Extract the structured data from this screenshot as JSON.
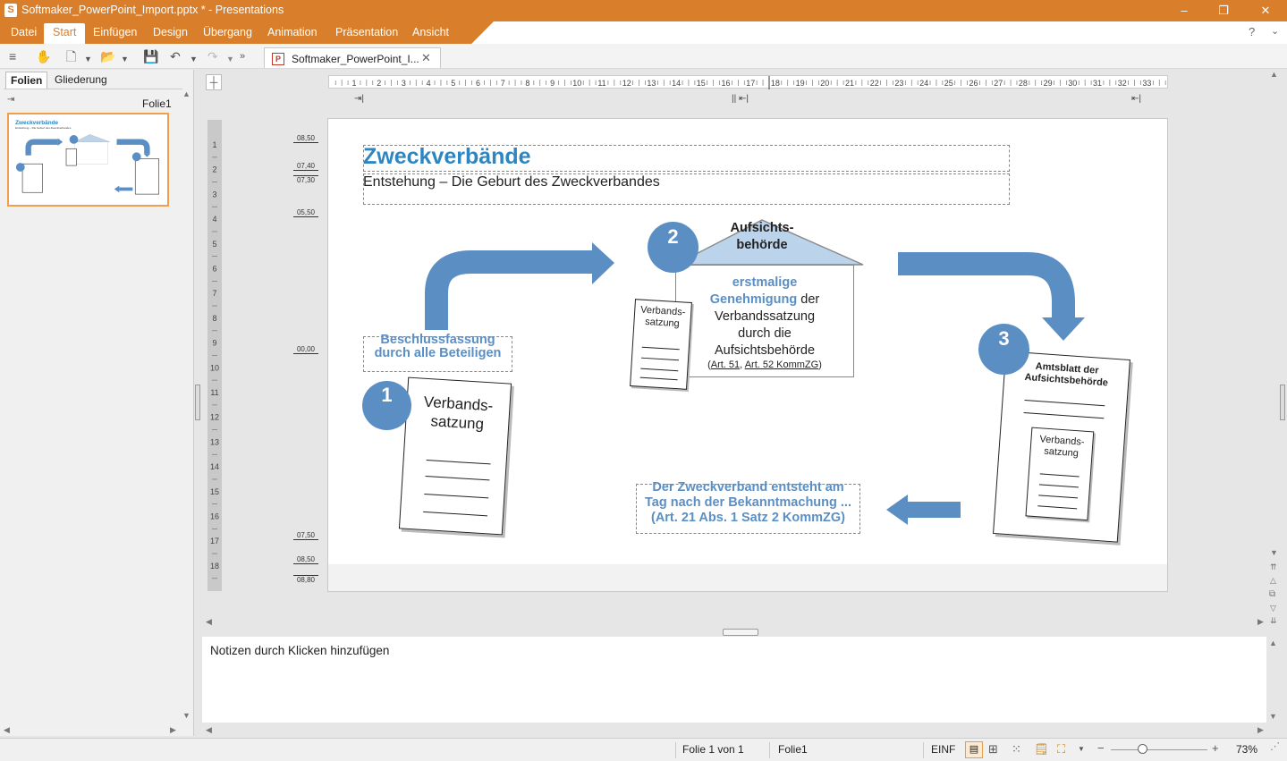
{
  "window": {
    "title": "Softmaker_PowerPoint_Import.pptx * - Presentations",
    "app_icon": "S"
  },
  "menu": [
    "Datei",
    "Start",
    "Einfügen",
    "Design",
    "Übergang",
    "Animation",
    "Präsentation",
    "Ansicht"
  ],
  "document_tab": "Softmaker_PowerPoint_I...",
  "left_panel": {
    "tabs": [
      "Folien",
      "Gliederung"
    ],
    "slide_label": "Folie1"
  },
  "horizontal_ruler_numbers": [
    "1",
    "2",
    "3",
    "4",
    "5",
    "6",
    "7",
    "8",
    "9",
    "10",
    "11",
    "12",
    "13",
    "14",
    "15",
    "16",
    "17",
    "18",
    "19",
    "20",
    "21",
    "22",
    "23",
    "24",
    "25",
    "26",
    "27",
    "28",
    "29",
    "30",
    "31",
    "32",
    "33"
  ],
  "vertical_ruler_numbers": [
    "1",
    "2",
    "3",
    "4",
    "5",
    "6",
    "7",
    "8",
    "9",
    "10",
    "11",
    "12",
    "13",
    "14",
    "15",
    "16",
    "17",
    "18"
  ],
  "guides": [
    "08,50",
    "07,40",
    "07,30",
    "05,50",
    "00,00",
    "07,50",
    "08,50",
    "08,80"
  ],
  "slide": {
    "title": "Zweckverbände",
    "subtitle": "Entstehung – Die Geburt des Zweckverbandes",
    "step1": {
      "num": "1",
      "label_line1": "Beschlussfassung",
      "label_line2": "durch alle Beteiligen",
      "doc_line1": "Verbands-",
      "doc_line2": "satzung"
    },
    "step2": {
      "num": "2",
      "roof_line1": "Aufsichts-",
      "roof_line2": "behörde",
      "b1": "erstmalige",
      "b2a": "Genehmigung",
      "b2b": " der",
      "b3": "Verbandssatzung",
      "b4": "durch die",
      "b5": "Aufsichtsbehörde",
      "ref_open": "(",
      "ref1": "Art. 51",
      "ref_comma": ", ",
      "ref2": "Art. 52 KommZG",
      "ref_close": ")",
      "doc_line1": "Verbands-",
      "doc_line2": "satzung"
    },
    "step3": {
      "num": "3",
      "header_line1": "Amtsblatt der",
      "header_line2": "Aufsichtsbehörde",
      "doc_line1": "Verbands-",
      "doc_line2": "satzung"
    },
    "result": {
      "line1": "Der Zweckverband entsteht am",
      "line2": "Tag nach der Bekanntmachung ...",
      "line3": "(Art. 21 Abs. 1 Satz 2 KommZG)"
    }
  },
  "notes_placeholder": "Notizen durch Klicken hinzufügen",
  "status": {
    "slide_of": "Folie 1 von 1",
    "slide_name": "Folie1",
    "mode": "EINF",
    "zoom": "73%"
  },
  "colors": {
    "accent": "#d97f2b",
    "diagram_blue": "#5b8fc4",
    "title_blue": "#2e86c1",
    "roof": "#bcd3ec"
  }
}
